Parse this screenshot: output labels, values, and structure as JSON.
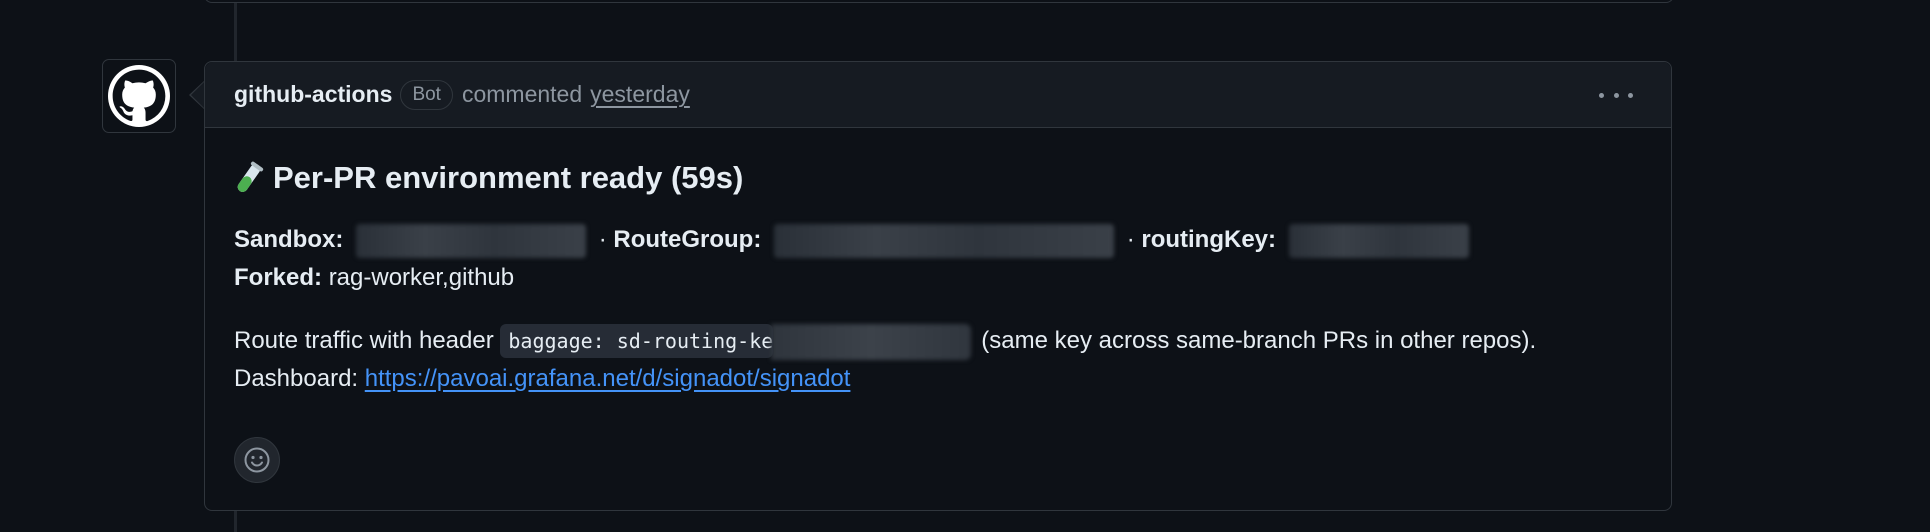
{
  "comment": {
    "author": "github-actions",
    "badge": "Bot",
    "action": "commented",
    "timestamp": "yesterday",
    "title": "Per-PR environment ready (59s)",
    "sandbox_label": "Sandbox:",
    "separator": "·",
    "routegroup_label": "RouteGroup:",
    "routingkey_label": "routingKey:",
    "forked_label": "Forked:",
    "forked_value": "rag-worker,github",
    "route_text": "Route traffic with header",
    "code_visible": "baggage: sd-routing-ke",
    "route_suffix": "(same key across same-branch PRs in other repos).",
    "dashboard_label": "Dashboard:",
    "dashboard_url": "https://pavoai.grafana.net/d/signadot/signadot"
  },
  "icons": {
    "avatar": "github-octocat-icon",
    "menu": "kebab-horizontal-icon",
    "reaction": "smiley-icon",
    "title_emoji": "test-tube-icon"
  },
  "colors": {
    "background": "#0d1117",
    "header": "#161b22",
    "border": "#30363d",
    "text": "#e6edf3",
    "muted": "#8d96a0",
    "link": "#4493f8"
  }
}
